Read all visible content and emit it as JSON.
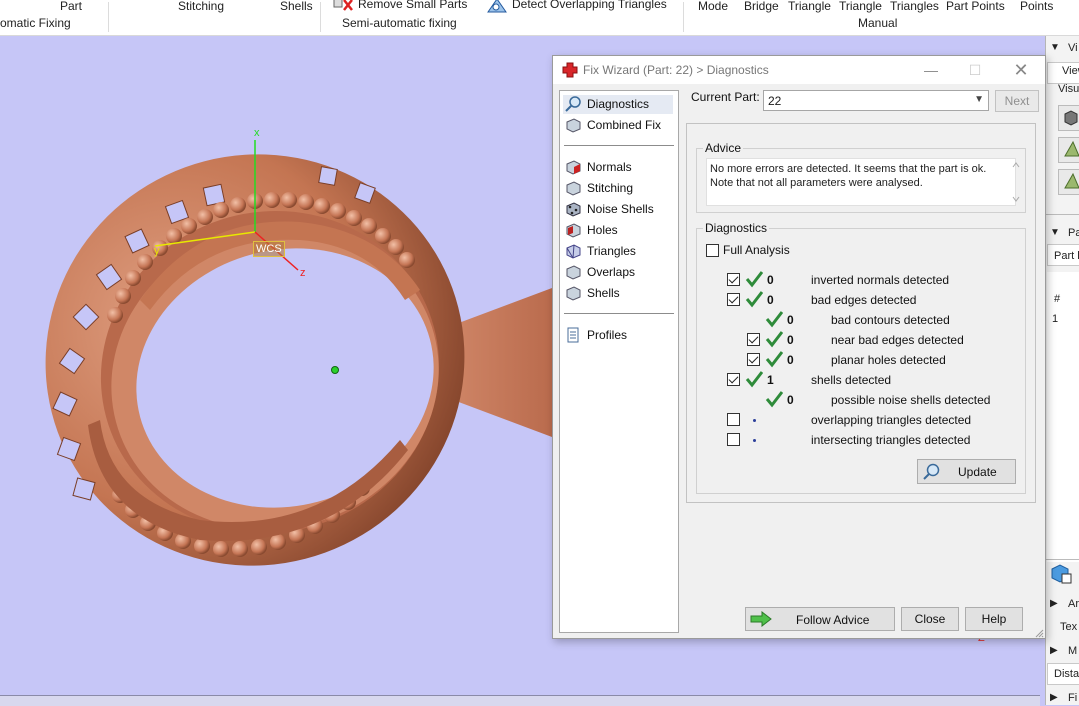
{
  "ribbon": {
    "part_label": "Part",
    "stitching_label": "Stitching",
    "shells_label": "Shells",
    "remove_small_parts_label": "Remove Small Parts",
    "detect_overlapping_label": "Detect Overlapping Triangles",
    "mode_label": "Mode",
    "bridge_label": "Bridge",
    "triangle1_label": "Triangle",
    "triangle2_label": "Triangle",
    "triangles_label": "Triangles",
    "part_points_label": "Part Points",
    "points_label": "Points",
    "automatic_fixing_group": "omatic Fixing",
    "semi_automatic_group": "Semi-automatic fixing",
    "manual_group": "Manual"
  },
  "viewport": {
    "wcs_label": "WCS",
    "axis_x": "x",
    "axis_y": "y",
    "axis_z": "z",
    "corner_axis": "Z",
    "colors": {
      "background": "#c6c6f7",
      "model": "#c47552"
    }
  },
  "right_panel": {
    "view_tab": "Vi",
    "view_sub": "View",
    "visual_label": "Visua",
    "parts_header": "Pa",
    "part_col": "Part l",
    "hash_col": "#",
    "row1_index": "1",
    "an_label": "Ar",
    "tex_label": "Tex",
    "m_label": "M",
    "dista_label": "Dista",
    "fi_label": "Fi"
  },
  "dialog": {
    "title": "Fix Wizard (Part: 22) > Diagnostics",
    "nav": {
      "diagnostics": "Diagnostics",
      "combined_fix": "Combined Fix",
      "normals": "Normals",
      "stitching": "Stitching",
      "noise_shells": "Noise Shells",
      "holes": "Holes",
      "triangles": "Triangles",
      "overlaps": "Overlaps",
      "shells": "Shells",
      "profiles": "Profiles"
    },
    "current_part_label": "Current Part:",
    "current_part_value": "22",
    "next_button": "Next",
    "advice_title": "Advice",
    "advice_text": "No more errors are detected. It seems that the part is ok. Note that not all parameters were analysed.",
    "diagnostics_title": "Diagnostics",
    "full_analysis_label": "Full Analysis",
    "full_analysis_checked": false,
    "rows": [
      {
        "count": "0",
        "label": "inverted normals detected",
        "checked": true,
        "status": "ok"
      },
      {
        "count": "0",
        "label": "bad edges detected",
        "checked": true,
        "status": "ok"
      },
      {
        "count": "0",
        "label": "bad contours detected",
        "checked": null,
        "status": "ok"
      },
      {
        "count": "0",
        "label": "near bad edges detected",
        "checked": true,
        "status": "ok"
      },
      {
        "count": "0",
        "label": "planar holes detected",
        "checked": true,
        "status": "ok"
      },
      {
        "count": "1",
        "label": "shells detected",
        "checked": true,
        "status": "ok"
      },
      {
        "count": "0",
        "label": "possible noise shells detected",
        "checked": null,
        "status": "ok"
      },
      {
        "count": "",
        "label": "overlapping triangles detected",
        "checked": false,
        "status": "pending"
      },
      {
        "count": "",
        "label": "intersecting triangles detected",
        "checked": false,
        "status": "pending"
      }
    ],
    "update_button": "Update",
    "follow_advice_button": "Follow Advice",
    "close_button": "Close",
    "help_button": "Help",
    "colors": {
      "tick": "#2e8b3a",
      "nav_active": "#e5eaf3"
    }
  }
}
